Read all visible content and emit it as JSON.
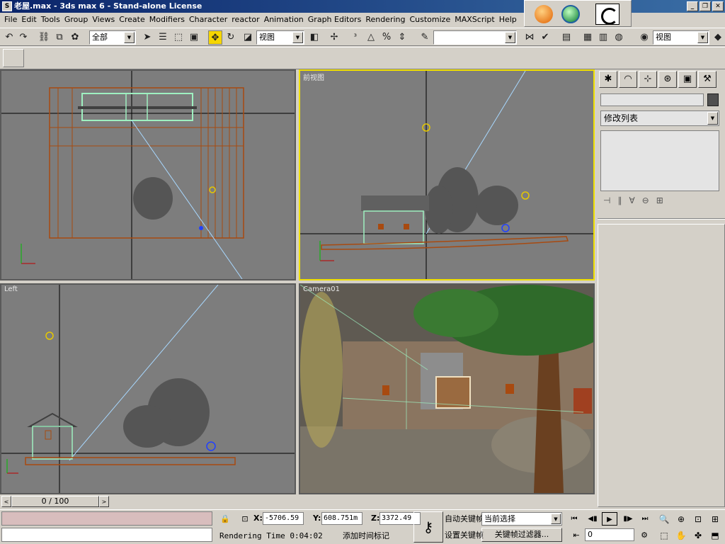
{
  "window": {
    "title": "老屋.max - 3ds max 6 - Stand-alone License",
    "minimize": "_",
    "restore": "❐",
    "close": "✕"
  },
  "menu": [
    "File",
    "Edit",
    "Tools",
    "Group",
    "Views",
    "Create",
    "Modifiers",
    "Character",
    "reactor",
    "Animation",
    "Graph Editors",
    "Rendering",
    "Customize",
    "MAXScript",
    "Help"
  ],
  "toolbar": {
    "selection_filter": "全部",
    "reference_coord": "视图",
    "named_selection": "",
    "render_type": "视图"
  },
  "viewports": {
    "top": {
      "label": ""
    },
    "front": {
      "label": "前视图"
    },
    "left": {
      "label": "Left"
    },
    "camera": {
      "label": "Camera01"
    }
  },
  "command_panel": {
    "object_name": "",
    "color": "#505050",
    "modifier_list": "修改列表"
  },
  "timeslider": {
    "position": "0 / 100"
  },
  "status": {
    "x_label": "X:",
    "x_value": "-5706.59",
    "y_label": "Y:",
    "y_value": "608.751m",
    "z_label": "Z:",
    "z_value": "3372.49",
    "render_time": "Rendering Time  0:04:02",
    "add_time_tag": "添加时间标记",
    "auto_key": "自动关键帧",
    "set_key": "设置关键帧",
    "selection_mode": "当前选择",
    "key_filters": "关键帧过滤器...",
    "current_frame": "0"
  },
  "colors": {
    "viewport_bg": "#7d7d7d",
    "active_border": "#f0e000",
    "wire_orange": "#a84a10",
    "wire_green": "#9ef0c0",
    "camera_line": "#a8d8ff"
  }
}
